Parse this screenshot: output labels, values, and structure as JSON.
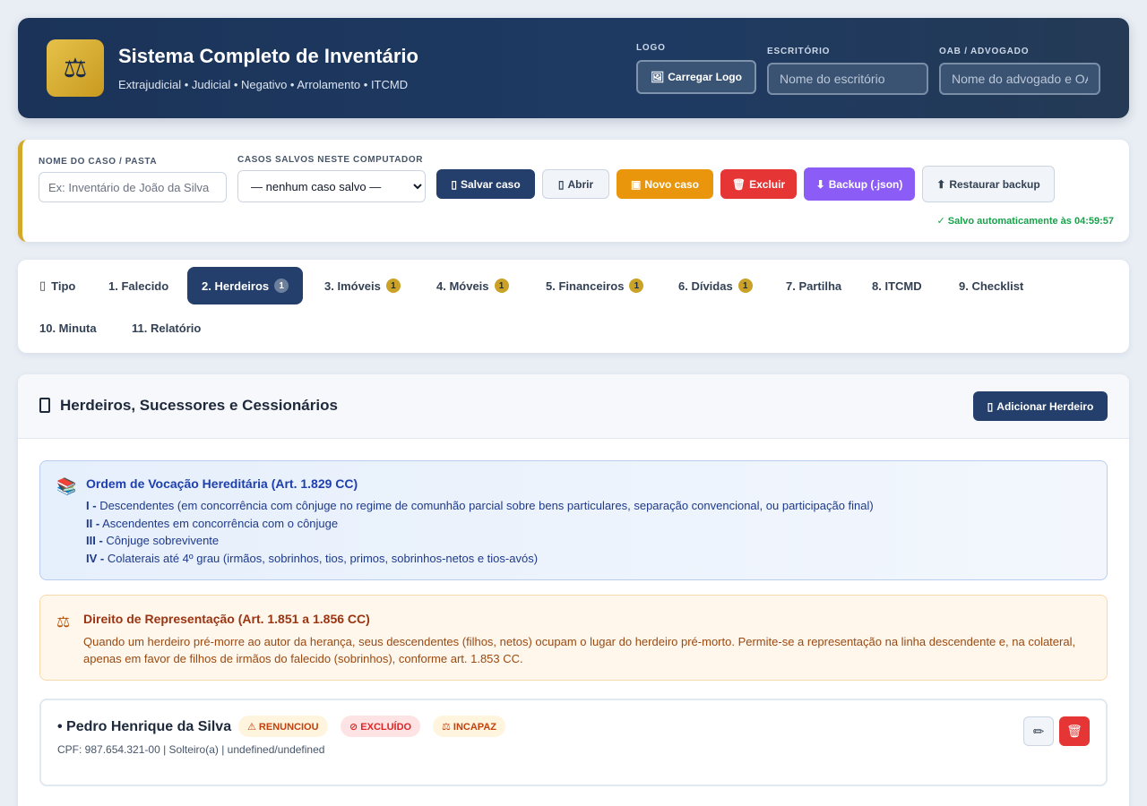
{
  "header": {
    "icon": "balance-scale-icon",
    "title": "Sistema Completo de Inventário",
    "subtitle": "Extrajudicial • Judicial • Negativo • Arrolamento • ITCMD",
    "logo_label": "LOGO",
    "logo_button": "Carregar Logo",
    "office_label": "ESCRITÓRIO",
    "office_placeholder": "Nome do escritório",
    "oab_label": "OAB / ADVOGADO",
    "oab_placeholder": "Nome do advogado e OAB"
  },
  "casebar": {
    "name_label": "NOME DO CASO / PASTA",
    "name_placeholder": "Ex: Inventário de João da Silva",
    "saved_label": "CASOS SALVOS NESTE COMPUTADOR",
    "saved_selected": "— nenhum caso salvo —",
    "buttons": {
      "save": "Salvar caso",
      "open": "Abrir",
      "new": "Novo caso",
      "delete": "Excluir",
      "backup": "Backup (.json)",
      "restore": "Restaurar backup"
    },
    "autosave": "✓ Salvo automaticamente às 04:59:57"
  },
  "tabs": [
    {
      "label": "Tipo",
      "badge": ""
    },
    {
      "label": "1. Falecido",
      "badge": ""
    },
    {
      "label": "2. Herdeiros",
      "badge": "1"
    },
    {
      "label": "3. Imóveis",
      "badge": "1"
    },
    {
      "label": "4. Móveis",
      "badge": "1"
    },
    {
      "label": "5. Financeiros",
      "badge": "1"
    },
    {
      "label": "6. Dívidas",
      "badge": "1"
    },
    {
      "label": "7. Partilha",
      "badge": ""
    },
    {
      "label": "8. ITCMD",
      "badge": ""
    },
    {
      "label": "9. Checklist",
      "badge": ""
    },
    {
      "label": "10. Minuta",
      "badge": ""
    },
    {
      "label": "11. Relatório",
      "badge": ""
    }
  ],
  "active_tab": "2. Herdeiros",
  "panel": {
    "title": "Herdeiros, Sucessores e Cessionários",
    "add_button": "Adicionar Herdeiro",
    "vocation": {
      "title": "Ordem de Vocação Hereditária (Art. 1.829 CC)",
      "lines": [
        {
          "num": "I -",
          "text": "Descendentes (em concorrência com cônjuge no regime de comunhão parcial sobre bens particulares, separação convencional, ou participação final)"
        },
        {
          "num": "II -",
          "text": "Ascendentes em concorrência com o cônjuge"
        },
        {
          "num": "III -",
          "text": "Cônjuge sobrevivente"
        },
        {
          "num": "IV -",
          "text": "Colaterais até 4º grau (irmãos, sobrinhos, tios, primos, sobrinhos-netos e tios-avós)"
        }
      ]
    },
    "representation": {
      "title": "Direito de Representação (Art. 1.851 a 1.856 CC)",
      "text": "Quando um herdeiro pré-morre ao autor da herança, seus descendentes (filhos, netos) ocupam o lugar do herdeiro pré-morto. Permite-se a representação na linha descendente e, na colateral, apenas em favor de filhos de irmãos do falecido (sobrinhos), conforme art. 1.853 CC."
    },
    "heir": {
      "name": "• Pedro Henrique da Silva",
      "badges": [
        "⚠ RENUNCIOU",
        "⊘ EXCLUÍDO",
        "⚖ INCAPAZ"
      ],
      "meta": "CPF: 987.654.321-00 | Solteiro(a) | undefined/undefined"
    }
  }
}
